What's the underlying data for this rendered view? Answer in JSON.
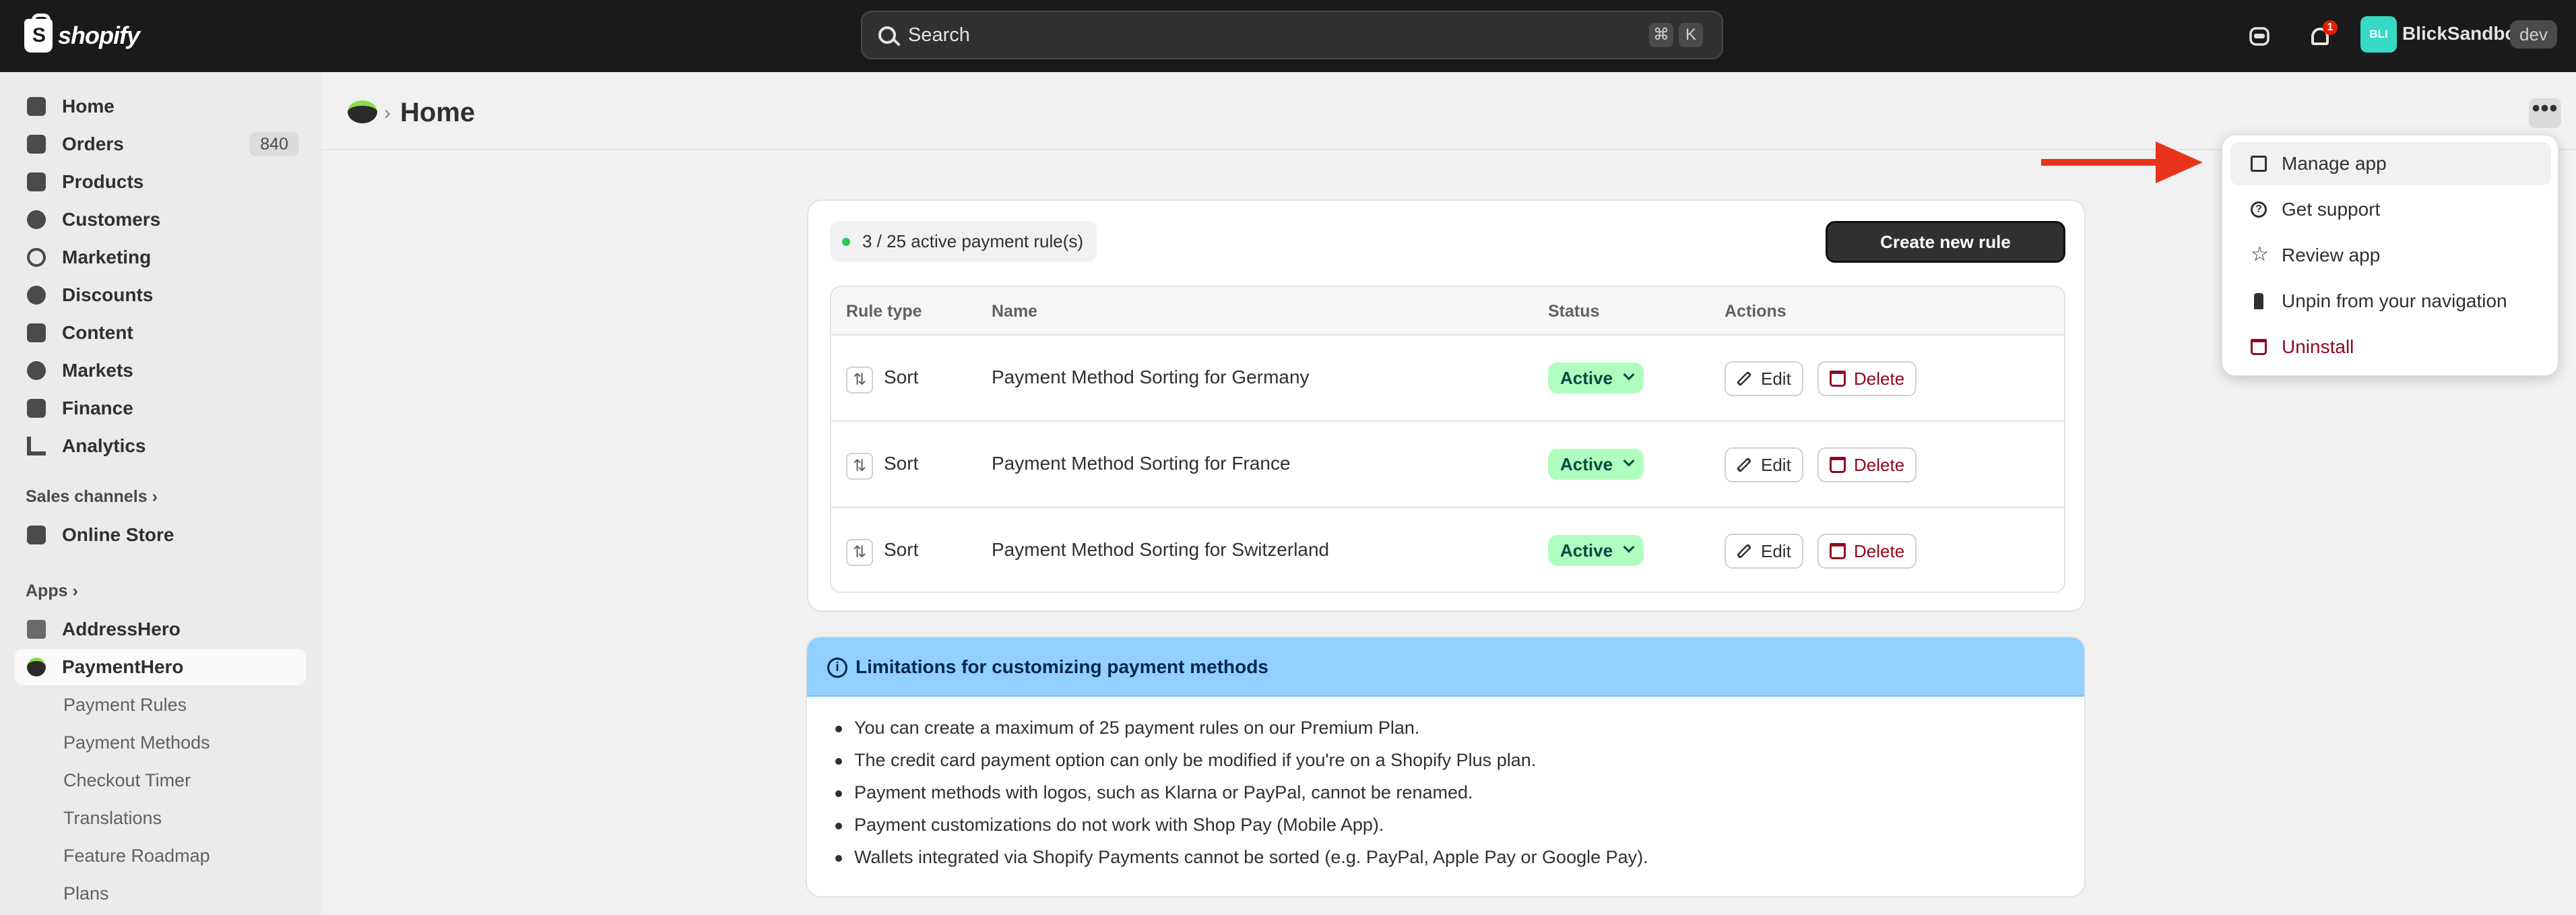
{
  "topbar": {
    "logo_text": "shopify",
    "search_placeholder": "Search",
    "shortcut_keys": [
      "⌘",
      "K"
    ],
    "notification_count": "1",
    "avatar_initials": "BLI",
    "store_name": "BlickSandbox",
    "env_badge": "dev"
  },
  "sidebar": {
    "items": [
      {
        "label": "Home",
        "icon": "home-icon"
      },
      {
        "label": "Orders",
        "icon": "orders-icon",
        "count": "840"
      },
      {
        "label": "Products",
        "icon": "tag-icon"
      },
      {
        "label": "Customers",
        "icon": "person-icon"
      },
      {
        "label": "Marketing",
        "icon": "target-icon"
      },
      {
        "label": "Discounts",
        "icon": "discount-icon"
      },
      {
        "label": "Content",
        "icon": "content-icon"
      },
      {
        "label": "Markets",
        "icon": "globe-icon"
      },
      {
        "label": "Finance",
        "icon": "bank-icon"
      },
      {
        "label": "Analytics",
        "icon": "chart-icon"
      }
    ],
    "sales_channels_label": "Sales channels",
    "online_store_label": "Online Store",
    "apps_label": "Apps",
    "apps": [
      {
        "label": "AddressHero"
      },
      {
        "label": "PaymentHero"
      }
    ],
    "sub_items": [
      "Payment Rules",
      "Payment Methods",
      "Checkout Timer",
      "Translations",
      "Feature Roadmap",
      "Plans"
    ]
  },
  "page": {
    "breadcrumb_sep": "›",
    "title": "Home",
    "more_label": "•••"
  },
  "rules_card": {
    "active_summary": "3 / 25 active payment rule(s)",
    "create_button": "Create new rule",
    "columns": [
      "Rule type",
      "Name",
      "Status",
      "Actions"
    ],
    "rows": [
      {
        "type": "Sort",
        "name": "Payment Method Sorting for Germany",
        "status": "Active"
      },
      {
        "type": "Sort",
        "name": "Payment Method Sorting for France",
        "status": "Active"
      },
      {
        "type": "Sort",
        "name": "Payment Method Sorting for Switzerland",
        "status": "Active"
      }
    ],
    "edit_label": "Edit",
    "delete_label": "Delete"
  },
  "banner": {
    "title": "Limitations for customizing payment methods",
    "bullets": [
      "You can create a maximum of 25 payment rules on our Premium Plan.",
      "The credit card payment option can only be modified if you're on a Shopify Plus plan.",
      "Payment methods with logos, such as Klarna or PayPal, cannot be renamed.",
      "Payment customizations do not work with Shop Pay (Mobile App).",
      "Wallets integrated via Shopify Payments cannot be sorted (e.g. PayPal, Apple Pay or Google Pay)."
    ]
  },
  "dropdown": {
    "items": [
      {
        "label": "Manage app",
        "icon": "manage-app-icon"
      },
      {
        "label": "Get support",
        "icon": "help-icon"
      },
      {
        "label": "Review app",
        "icon": "star-icon"
      },
      {
        "label": "Unpin from your navigation",
        "icon": "pin-icon"
      },
      {
        "label": "Uninstall",
        "icon": "trash-icon"
      }
    ]
  },
  "colors": {
    "topbar_bg": "#1a1a1a",
    "sidebar_bg": "#ebebeb",
    "active_status_bg": "#affebf",
    "banner_bg": "#91d0ff",
    "danger": "#8e0b21",
    "arrow": "#e8341c"
  }
}
